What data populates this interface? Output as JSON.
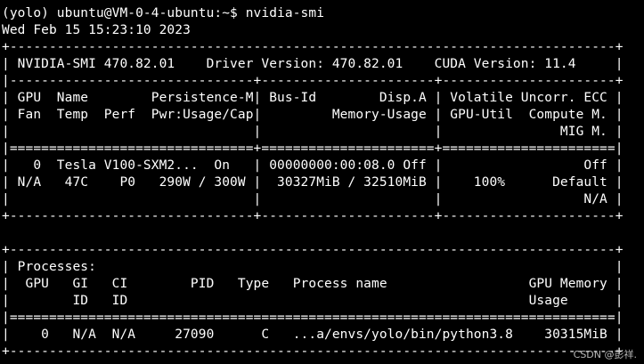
{
  "terminal": {
    "lines": [
      "(yolo) ubuntu@VM-0-4-ubuntu:~$ nvidia-smi",
      "Wed Feb 15 15:23:10 2023",
      "+-----------------------------------------------------------------------------+",
      "| NVIDIA-SMI 470.82.01    Driver Version: 470.82.01    CUDA Version: 11.4     |",
      "|-------------------------------+----------------------+----------------------+",
      "| GPU  Name        Persistence-M| Bus-Id        Disp.A | Volatile Uncorr. ECC |",
      "| Fan  Temp  Perf  Pwr:Usage/Cap|         Memory-Usage | GPU-Util  Compute M. |",
      "|                               |                      |               MIG M. |",
      "|===============================+======================+======================|",
      "|   0  Tesla V100-SXM2...  On   | 00000000:00:08.0 Off |                  Off |",
      "| N/A   47C    P0   290W / 300W |  30327MiB / 32510MiB |    100%      Default |",
      "|                               |                      |                  N/A |",
      "+-------------------------------+----------------------+----------------------+",
      "",
      "+-----------------------------------------------------------------------------+",
      "| Processes:                                                                  |",
      "|  GPU   GI   CI        PID   Type   Process name                  GPU Memory |",
      "|        ID   ID                                                   Usage      |",
      "|=============================================================================|",
      "|    0   N/A  N/A     27090      C   ...a/envs/yolo/bin/python3.8    30315MiB |",
      "+-----------------------------------------------------------------------------+"
    ]
  },
  "watermark": "CSDN @彭祥.",
  "colors": {
    "background": "#000000",
    "foreground": "#ffffff"
  }
}
